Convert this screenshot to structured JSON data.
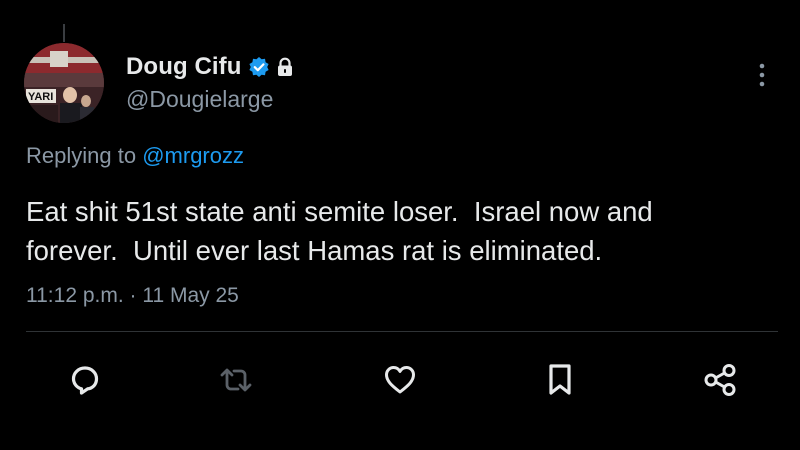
{
  "tweet": {
    "author": {
      "display_name": "Doug Cifu",
      "handle": "@Dougielarge",
      "verified": true,
      "protected": true,
      "avatar_banner_text": "YARI"
    },
    "replying_to": {
      "prefix": "Replying to",
      "mention": "@mrgrozz"
    },
    "text": "Eat shit 51st state anti semite loser.  Israel now and\nforever.  Until ever last Hamas rat is eliminated.",
    "timestamp": "11:12 p.m. · 11 May 25"
  },
  "actions": [
    {
      "name": "reply",
      "icon": "reply-icon"
    },
    {
      "name": "retweet",
      "icon": "retweet-icon"
    },
    {
      "name": "like",
      "icon": "heart-icon"
    },
    {
      "name": "bookmark",
      "icon": "bookmark-icon"
    },
    {
      "name": "share",
      "icon": "share-icon"
    }
  ],
  "colors": {
    "background": "#000000",
    "primary_text": "#e7e9ea",
    "secondary_text": "#8b98a5",
    "accent": "#1d9bf0",
    "divider": "#2f3336"
  }
}
